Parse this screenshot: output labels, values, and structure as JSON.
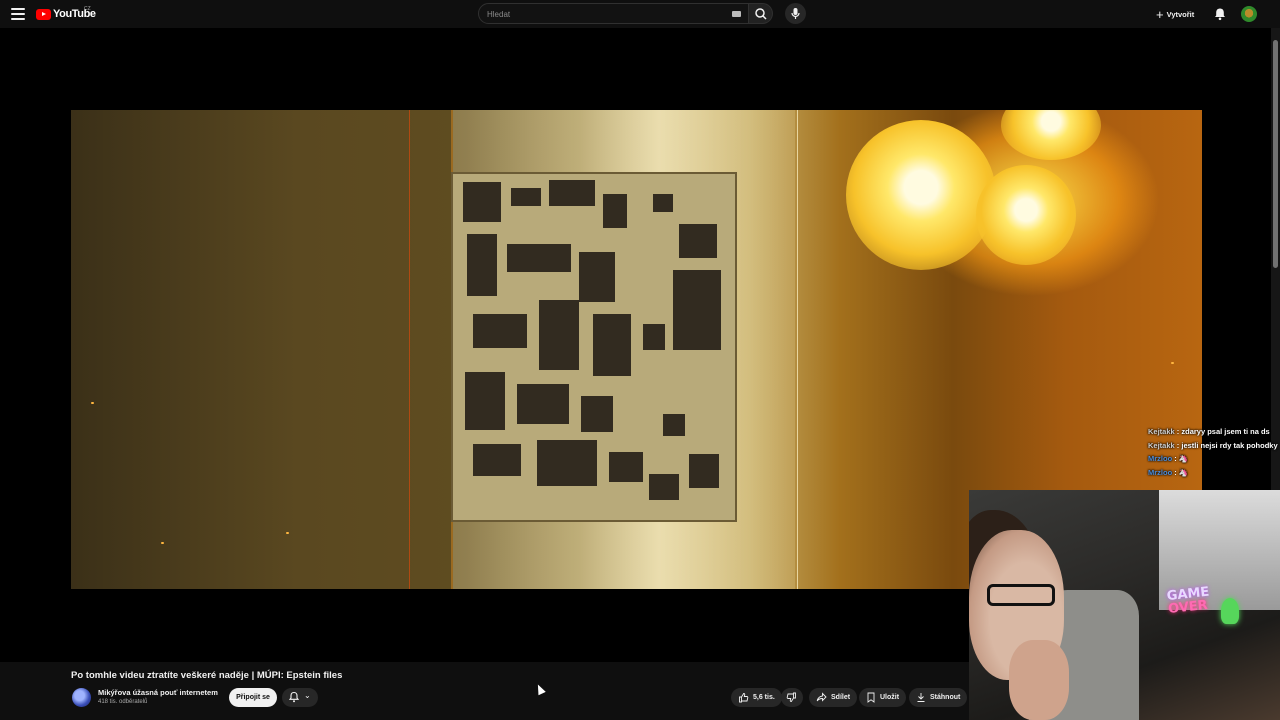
{
  "header": {
    "logo_text": "YouTube",
    "region": "CZ",
    "search_placeholder": "Hledat",
    "create_label": "Vytvořit"
  },
  "video": {
    "title": "Po tomhle videu ztratíte veškeré naděje | MÚPI: Epstein files"
  },
  "channel": {
    "name": "Mikýřova úžasná pouť internetem",
    "subscribers": "418 tis. odběratelů",
    "join_label": "Připojit se"
  },
  "actions": {
    "likes": "5,6 tis.",
    "share": "Sdílet",
    "save": "Uložit",
    "download": "Stáhnout"
  },
  "chat": [
    {
      "user": "Kejtakk",
      "message": "zdaryy psal jsem ti na ds"
    },
    {
      "user": "Kejtakk",
      "message": "jestli nejsi rdy tak pohodky"
    },
    {
      "user": "Mrzloo",
      "message": ""
    },
    {
      "user": "Mrzloo",
      "message": ""
    }
  ],
  "webcam": {
    "sign_line1": "GAME",
    "sign_line2": "OVER"
  },
  "colors": {
    "background": "#0f0f0f",
    "brand_red": "#ff0000",
    "button_bg": "#272727",
    "chat_blue": "#4b8cd8"
  }
}
